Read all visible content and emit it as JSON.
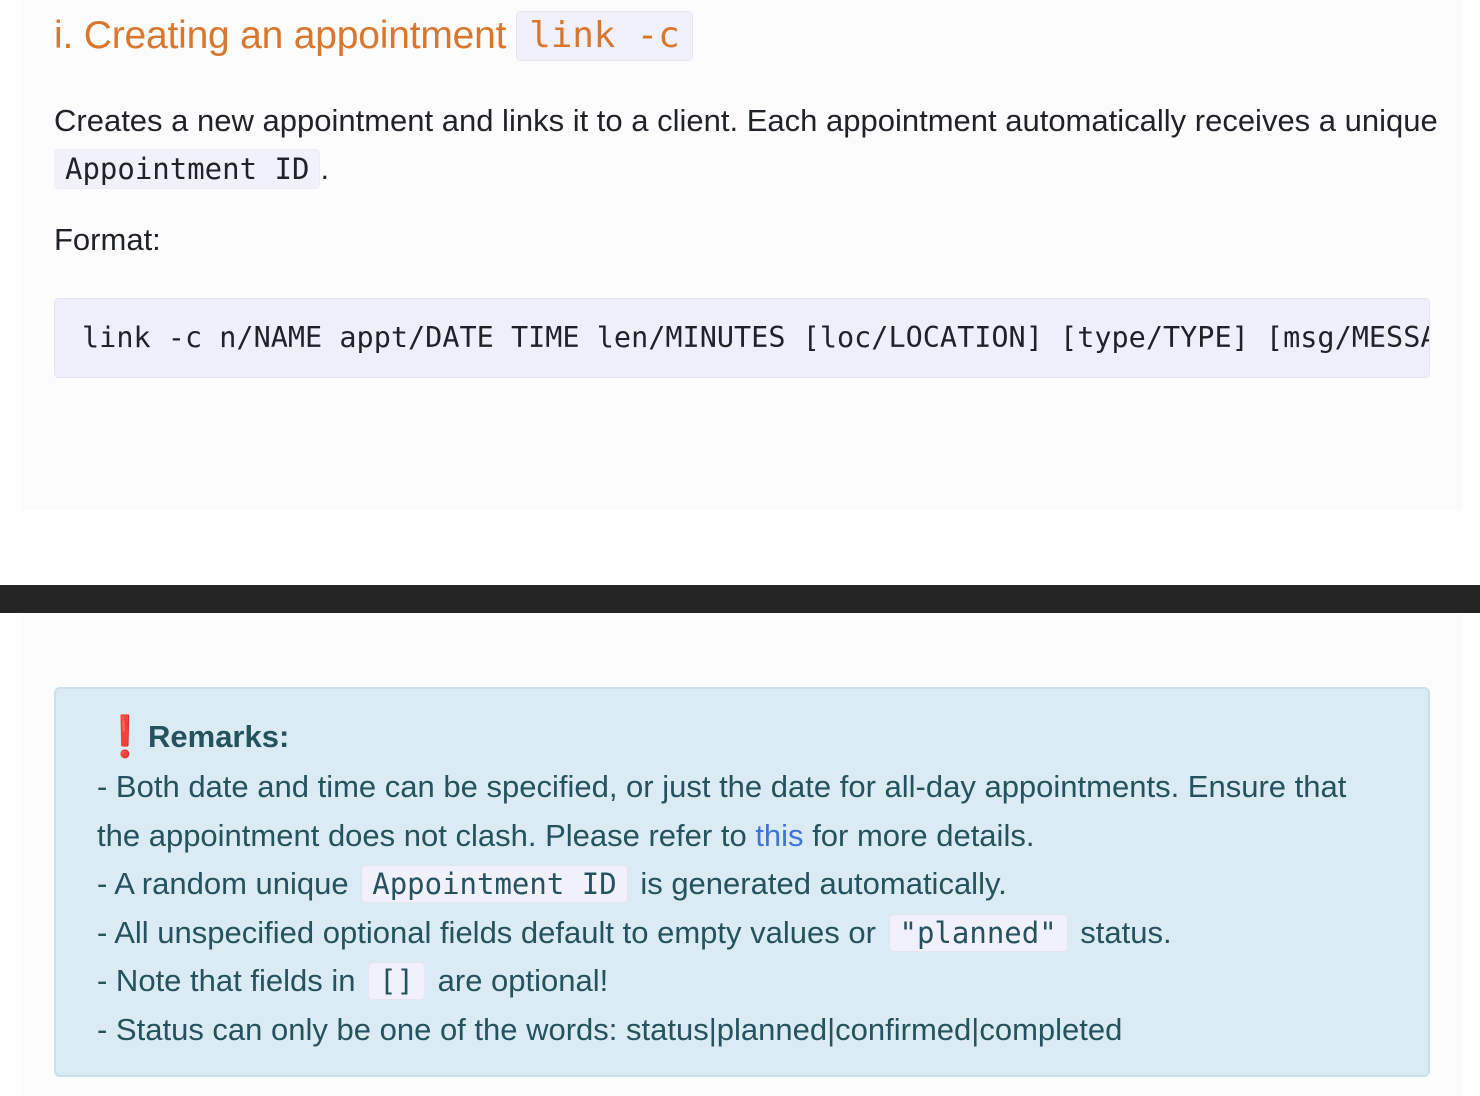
{
  "section": {
    "heading_text": "i. Creating an appointment",
    "heading_code": "link -c",
    "description_part1": "Creates a new appointment and links it to a client. Each appointment automatically receives a unique",
    "description_code": "Appointment ID",
    "description_part2": ".",
    "format_label": "Format:",
    "format_code": "link -c n/NAME appt/DATE TIME len/MINUTES [loc/LOCATION] [type/TYPE] [msg/MESSAGE]"
  },
  "remarks": {
    "title": "Remarks:",
    "icon": "exclamation-icon",
    "icon_glyph": "❗",
    "line1_part1": "- Both date and time can be specified, or just the date for all-day appointments. Ensure that the appointment does not clash. Please refer to",
    "line1_link": "this",
    "line1_part2": "for more details.",
    "line2_part1": "- A random unique",
    "line2_code": "Appointment ID",
    "line2_part2": "is generated automatically.",
    "line3_part1": "- All unspecified optional fields default to empty values or",
    "line3_code": "\"planned\"",
    "line3_part2": "status.",
    "line4_part1": "- Note that fields in",
    "line4_code": "[]",
    "line4_part2": "are optional!",
    "line5": "- Status can only be one of the words: status|planned|confirmed|completed"
  },
  "colors": {
    "heading": "#d9772f",
    "remarks_bg": "#dbebf3",
    "remarks_text": "#24525f",
    "link": "#3f74d6",
    "divider": "#252525"
  }
}
